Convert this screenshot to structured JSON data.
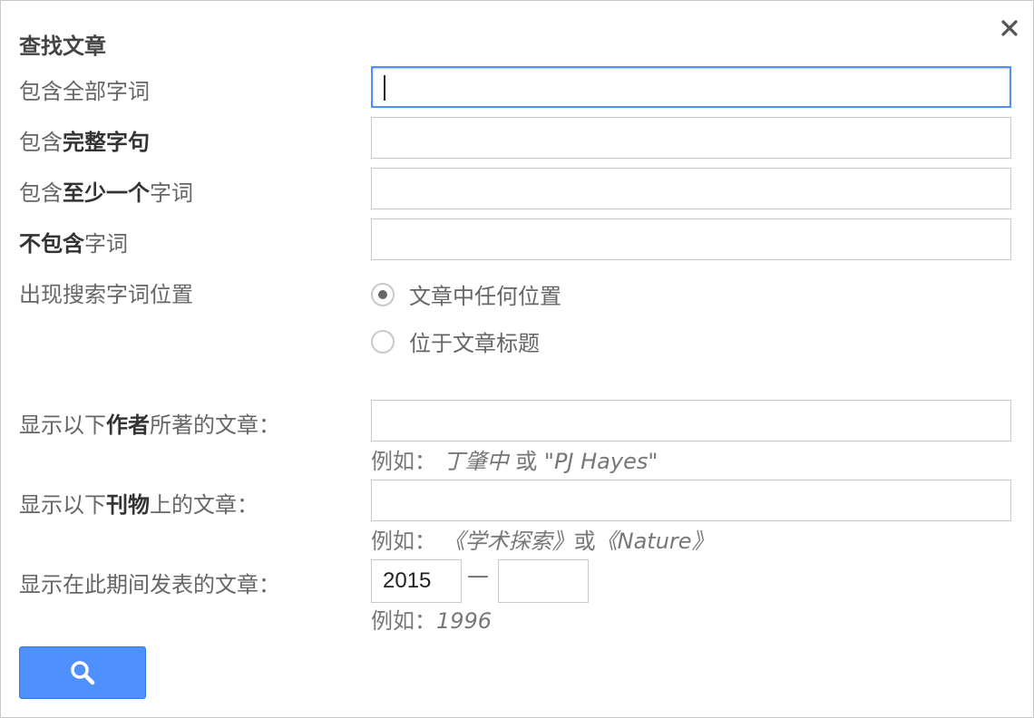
{
  "dialog": {
    "title": "查找文章",
    "close_icon": "close-icon"
  },
  "fields": {
    "all_words_label": "包含全部字词",
    "exact_phrase_label_pre": "包含",
    "exact_phrase_label_bold": "完整字句",
    "at_least_one_label_pre": "包含",
    "at_least_one_label_bold": "至少一个",
    "at_least_one_label_post": "字词",
    "without_words_label_bold": "不包含",
    "without_words_label_post": "字词",
    "all_words_value": "",
    "exact_phrase_value": "",
    "at_least_one_value": "",
    "without_words_value": ""
  },
  "occurrence": {
    "label": "出现搜索字词位置",
    "options": [
      "文章中任何位置",
      "位于文章标题"
    ],
    "selected": 0
  },
  "author": {
    "label_pre": "显示以下",
    "label_bold": "作者",
    "label_post": "所著的文章：",
    "value": "",
    "hint_prefix": "例如：",
    "hint_example1": "丁肇中",
    "hint_or": " 或 ",
    "hint_example2": "\"PJ Hayes\""
  },
  "publication": {
    "label_pre": "显示以下",
    "label_bold": "刊物",
    "label_post": "上的文章：",
    "value": "",
    "hint_prefix": "例如：",
    "hint_example1": "《学术探索》",
    "hint_or": "或",
    "hint_example2": "《Nature》"
  },
  "date_range": {
    "label": "显示在此期间发表的文章：",
    "from": "2015",
    "dash": "—",
    "to": "",
    "hint_prefix": "例如：",
    "hint_example": "1996"
  },
  "search_button": {
    "icon": "search-icon",
    "accent": "#4d90fe"
  }
}
